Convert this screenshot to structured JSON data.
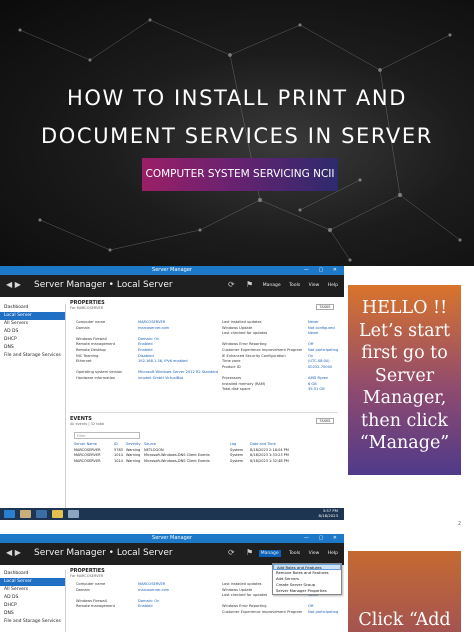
{
  "banner": {
    "title_line1": "HOW TO INSTALL PRINT AND",
    "title_line2": "DOCUMENT SERVICES IN SERVER",
    "badge": "COMPUTER SYSTEM SERVICING NCII",
    "badge_colors": [
      "#9a1f66",
      "#2e2a6e"
    ]
  },
  "caption1": [
    "HELLO !!",
    "Let’s start",
    "first go to",
    "Server",
    "Manager,",
    "then click",
    "“Manage”"
  ],
  "caption2": "Click “Add",
  "page_number": "2",
  "window": {
    "title": "Server Manager",
    "breadcrumb": "Server Manager • Local Server",
    "menus": [
      "Manage",
      "Tools",
      "View",
      "Help"
    ]
  },
  "sidebar": [
    "Dashboard",
    "Local Server",
    "All Servers",
    "AD DS",
    "DHCP",
    "DNS",
    "File and Storage Services"
  ],
  "properties": {
    "heading": "PROPERTIES",
    "subheading": "For MARCOSERVER",
    "tasks": "TASKS",
    "left": [
      [
        "Computer name",
        "MARCOSERVER"
      ],
      [
        "Domain",
        "marcoserver.com"
      ],
      [
        "",
        ""
      ],
      [
        "Windows Firewall",
        "Domain: On"
      ],
      [
        "Remote management",
        "Enabled"
      ],
      [
        "Remote Desktop",
        "Enabled"
      ],
      [
        "NIC Teaming",
        "Disabled"
      ],
      [
        "Ethernet",
        "192.168.1.36, IPv6 enabled"
      ],
      [
        "",
        ""
      ],
      [
        "Operating system version",
        "Microsoft Windows Server 2012 R2 Standard"
      ],
      [
        "Hardware information",
        "innotek GmbH VirtualBox"
      ]
    ],
    "right": [
      [
        "Last installed updates",
        "Never"
      ],
      [
        "Windows Update",
        "Not configured"
      ],
      [
        "Last checked for updates",
        "Never"
      ],
      [
        "",
        ""
      ],
      [
        "Windows Error Reporting",
        "Off"
      ],
      [
        "Customer Experience Improvement Program",
        "Not participating"
      ],
      [
        "IE Enhanced Security Configuration",
        "On"
      ],
      [
        "Time zone",
        "(UTC-08:00)"
      ],
      [
        "Product ID",
        "00252-70000"
      ],
      [
        "",
        ""
      ],
      [
        "Processors",
        "AMD Ryzen"
      ],
      [
        "Installed memory (RAM)",
        "6 GB"
      ],
      [
        "Total disk space",
        "39.51 GB"
      ]
    ]
  },
  "events": {
    "heading": "EVENTS",
    "subheading": "All events | 32 total",
    "filter_placeholder": "Filter",
    "tasks": "TASKS",
    "columns": [
      "Server Name",
      "ID",
      "Severity",
      "Source",
      "Log",
      "Date and Time"
    ],
    "rows": [
      [
        "MARCOSERVER",
        "5783",
        "Warning",
        "NETLOGON",
        "System",
        "8/18/2023 2:18:04 PM"
      ],
      [
        "MARCOSERVER",
        "1014",
        "Warning",
        "Microsoft-Windows-DNS Client Events",
        "System",
        "8/18/2023 1:33:23 PM"
      ],
      [
        "MARCOSERVER",
        "1014",
        "Warning",
        "Microsoft-Windows-DNS Client Events",
        "System",
        "8/18/2023 1:32:48 PM"
      ]
    ]
  },
  "taskbar": {
    "time": "3:57 PM",
    "date": "8/18/2023"
  },
  "manage_menu": [
    "Add Roles and Features",
    "Remove Roles and Features",
    "Add Servers",
    "Create Server Group",
    "Server Manager Properties"
  ],
  "shot2": {
    "sidebar": [
      "Dashboard",
      "Local Server",
      "All Servers",
      "AD DS",
      "DHCP",
      "DNS",
      "File and Storage Services"
    ],
    "props_left": [
      [
        "Computer name",
        "MARCOSERVER"
      ],
      [
        "Domain",
        "marcoserver.com"
      ],
      [
        "",
        ""
      ],
      [
        "Windows Firewall",
        "Domain: On"
      ],
      [
        "Remote management",
        "Enabled"
      ]
    ],
    "props_right": [
      [
        "Last installed updates",
        "Never"
      ],
      [
        "Windows Update",
        "Not configured"
      ],
      [
        "Last checked for updates",
        "Never"
      ],
      [
        "",
        ""
      ],
      [
        "Windows Error Reporting",
        "Off"
      ],
      [
        "Customer Experience Improvement Program",
        "Not participating"
      ]
    ]
  }
}
